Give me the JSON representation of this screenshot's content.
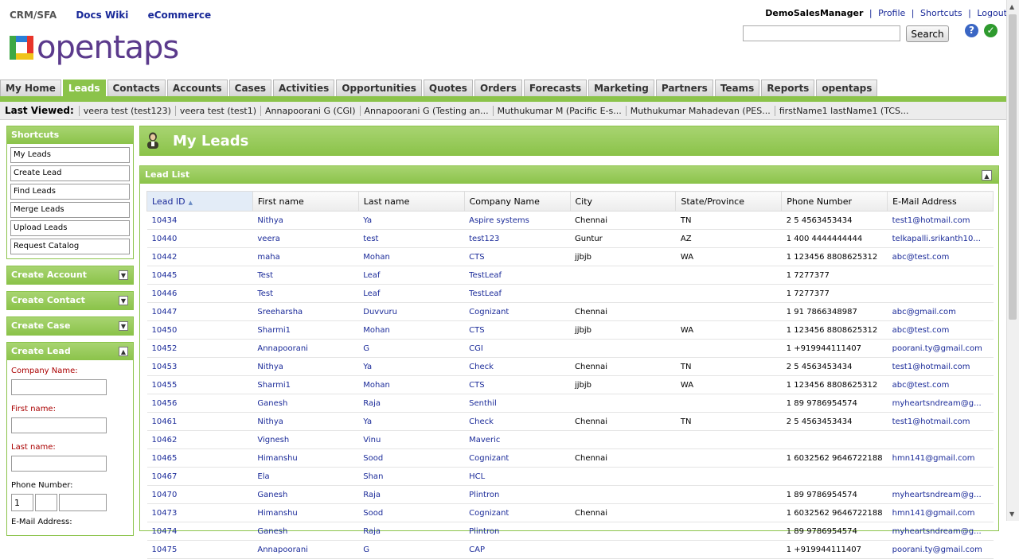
{
  "top_links": {
    "crm": "CRM/SFA",
    "docs": "Docs Wiki",
    "ecommerce": "eCommerce"
  },
  "logo_text": "opentaps",
  "user_bar": {
    "user": "DemoSalesManager",
    "profile": "Profile",
    "shortcuts": "Shortcuts",
    "logout": "Logout",
    "sep": "|"
  },
  "search": {
    "button": "Search",
    "value": ""
  },
  "header_icons": {
    "help": "?",
    "ok": "✓"
  },
  "tabs": [
    "My Home",
    "Leads",
    "Contacts",
    "Accounts",
    "Cases",
    "Activities",
    "Opportunities",
    "Quotes",
    "Orders",
    "Forecasts",
    "Marketing",
    "Partners",
    "Teams",
    "Reports",
    "opentaps"
  ],
  "active_tab": "Leads",
  "last_viewed": {
    "label": "Last Viewed:",
    "items": [
      "veera test (test123)",
      "veera test (test1)",
      "Annapoorani G (CGI)",
      "Annapoorani G (Testing an...",
      "Muthukumar M (Pacific E-s...",
      "Muthukumar Mahadevan (PES...",
      "firstName1 lastName1 (TCS..."
    ]
  },
  "shortcuts": {
    "title": "Shortcuts",
    "items": [
      "My Leads",
      "Create Lead",
      "Find Leads",
      "Merge Leads",
      "Upload Leads",
      "Request Catalog"
    ]
  },
  "collapsed_panels": [
    "Create Account",
    "Create Contact",
    "Create Case"
  ],
  "create_lead": {
    "title": "Create Lead",
    "company_label": "Company Name:",
    "first_label": "First name:",
    "last_label": "Last name:",
    "phone_label": "Phone Number:",
    "phone_country": "1",
    "email_label": "E-Mail Address:"
  },
  "toggle_glyphs": {
    "down": "▼",
    "up": "▲"
  },
  "main": {
    "title": "My Leads",
    "list_title": "Lead List"
  },
  "table": {
    "columns": [
      "Lead ID",
      "First name",
      "Last name",
      "Company Name",
      "City",
      "State/Province",
      "Phone Number",
      "E-Mail Address"
    ],
    "sort_indicator": "▲",
    "rows": [
      [
        "10434",
        "Nithya",
        "Ya",
        "Aspire systems",
        "Chennai",
        "TN",
        "2 5 4563453434",
        "test1@hotmail.com"
      ],
      [
        "10440",
        "veera",
        "test",
        "test123",
        "Guntur",
        "AZ",
        "1 400 4444444444",
        "telkapalli.srikanth10..."
      ],
      [
        "10442",
        "maha",
        "Mohan",
        "CTS",
        "jjbjb",
        "WA",
        "1 123456 8808625312",
        "abc@test.com"
      ],
      [
        "10445",
        "Test",
        "Leaf",
        "TestLeaf",
        "",
        "",
        "1 7277377",
        ""
      ],
      [
        "10446",
        "Test",
        "Leaf",
        "TestLeaf",
        "",
        "",
        "1 7277377",
        ""
      ],
      [
        "10447",
        "Sreeharsha",
        "Duvvuru",
        "Cognizant",
        "Chennai",
        "",
        "1 91 7866348987",
        "abc@gmail.com"
      ],
      [
        "10450",
        "Sharmi1",
        "Mohan",
        "CTS",
        "jjbjb",
        "WA",
        "1 123456 8808625312",
        "abc@test.com"
      ],
      [
        "10452",
        "Annapoorani",
        "G",
        "CGI",
        "",
        "",
        "1 +919944111407",
        "poorani.ty@gmail.com"
      ],
      [
        "10453",
        "Nithya",
        "Ya",
        "Check",
        "Chennai",
        "TN",
        "2 5 4563453434",
        "test1@hotmail.com"
      ],
      [
        "10455",
        "Sharmi1",
        "Mohan",
        "CTS",
        "jjbjb",
        "WA",
        "1 123456 8808625312",
        "abc@test.com"
      ],
      [
        "10456",
        "Ganesh",
        "Raja",
        "Senthil",
        "",
        "",
        "1 89 9786954574",
        "myheartsndream@g..."
      ],
      [
        "10461",
        "Nithya",
        "Ya",
        "Check",
        "Chennai",
        "TN",
        "2 5 4563453434",
        "test1@hotmail.com"
      ],
      [
        "10462",
        "Vignesh",
        "Vinu",
        "Maveric",
        "",
        "",
        "",
        ""
      ],
      [
        "10465",
        "Himanshu",
        "Sood",
        "Cognizant",
        "Chennai",
        "",
        "1 6032562 9646722188",
        "hmn141@gmail.com"
      ],
      [
        "10467",
        "Ela",
        "Shan",
        "HCL",
        "",
        "",
        "",
        ""
      ],
      [
        "10470",
        "Ganesh",
        "Raja",
        "Plintron",
        "",
        "",
        "1 89 9786954574",
        "myheartsndream@g..."
      ],
      [
        "10473",
        "Himanshu",
        "Sood",
        "Cognizant",
        "Chennai",
        "",
        "1 6032562 9646722188",
        "hmn141@gmail.com"
      ],
      [
        "10474",
        "Ganesh",
        "Raja",
        "Plintron",
        "",
        "",
        "1 89 9786954574",
        "myheartsndream@g..."
      ],
      [
        "10475",
        "Annapoorani",
        "G",
        "CAP",
        "",
        "",
        "1 +919944111407",
        "poorani.ty@gmail.com"
      ]
    ]
  },
  "colors": {
    "green": "#8bc34a",
    "link": "#1a2a99",
    "required": "#aa0000"
  }
}
